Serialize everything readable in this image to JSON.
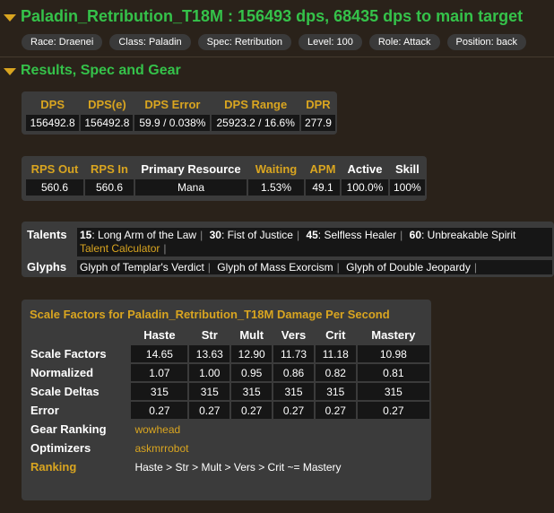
{
  "header": {
    "title": "Paladin_Retribution_T18M : 156493 dps, 68435 dps to main target",
    "tags": [
      "Race: Draenei",
      "Class: Paladin",
      "Spec: Retribution",
      "Level: 100",
      "Role: Attack",
      "Position: back"
    ]
  },
  "section": {
    "title": "Results, Spec and Gear"
  },
  "dps_table": {
    "headers": [
      "DPS",
      "DPS(e)",
      "DPS Error",
      "DPS Range",
      "DPR"
    ],
    "values": [
      "156492.8",
      "156492.8",
      "59.9 / 0.038%",
      "25923.2 / 16.6%",
      "277.9"
    ]
  },
  "resource_table": {
    "headers": [
      "RPS Out",
      "RPS In",
      "Primary Resource",
      "Waiting",
      "APM",
      "Active",
      "Skill"
    ],
    "values": [
      "560.6",
      "560.6",
      "Mana",
      "1.53%",
      "49.1",
      "100.0%",
      "100%"
    ]
  },
  "talents": {
    "label": "Talents",
    "items": [
      {
        "level": "15",
        "name": ": Long Arm of the Law"
      },
      {
        "level": "30",
        "name": ": Fist of Justice"
      },
      {
        "level": "45",
        "name": ": Selfless Healer"
      },
      {
        "level": "60",
        "name": ": Unbreakable Spirit"
      }
    ],
    "calculator": "Talent Calculator"
  },
  "glyphs": {
    "label": "Glyphs",
    "items": [
      "Glyph of Templar's Verdict",
      "Glyph of Mass Exorcism",
      "Glyph of Double Jeopardy"
    ]
  },
  "scale_factors": {
    "title": "Scale Factors for Paladin_Retribution_T18M Damage Per Second",
    "columns": [
      "Haste",
      "Str",
      "Mult",
      "Vers",
      "Crit",
      "Mastery"
    ],
    "rows": [
      {
        "label": "Scale Factors",
        "values": [
          "14.65",
          "13.63",
          "12.90",
          "11.73",
          "11.18",
          "10.98"
        ]
      },
      {
        "label": "Normalized",
        "values": [
          "1.07",
          "1.00",
          "0.95",
          "0.86",
          "0.82",
          "0.81"
        ]
      },
      {
        "label": "Scale Deltas",
        "values": [
          "315",
          "315",
          "315",
          "315",
          "315",
          "315"
        ]
      },
      {
        "label": "Error",
        "values": [
          "0.27",
          "0.27",
          "0.27",
          "0.27",
          "0.27",
          "0.27"
        ]
      }
    ],
    "gear_ranking_label": "Gear Ranking",
    "gear_ranking_link": "wowhead",
    "optimizers_label": "Optimizers",
    "optimizers_link": "askmrrobot",
    "ranking_label": "Ranking",
    "ranking_value": "Haste > Str > Mult > Vers > Crit ~= Mastery"
  },
  "colors": {
    "heading_green": "#35c24a",
    "gold": "#d9a520",
    "background": "#2a221a",
    "panel": "#3b3b3b",
    "cell": "#161616"
  }
}
